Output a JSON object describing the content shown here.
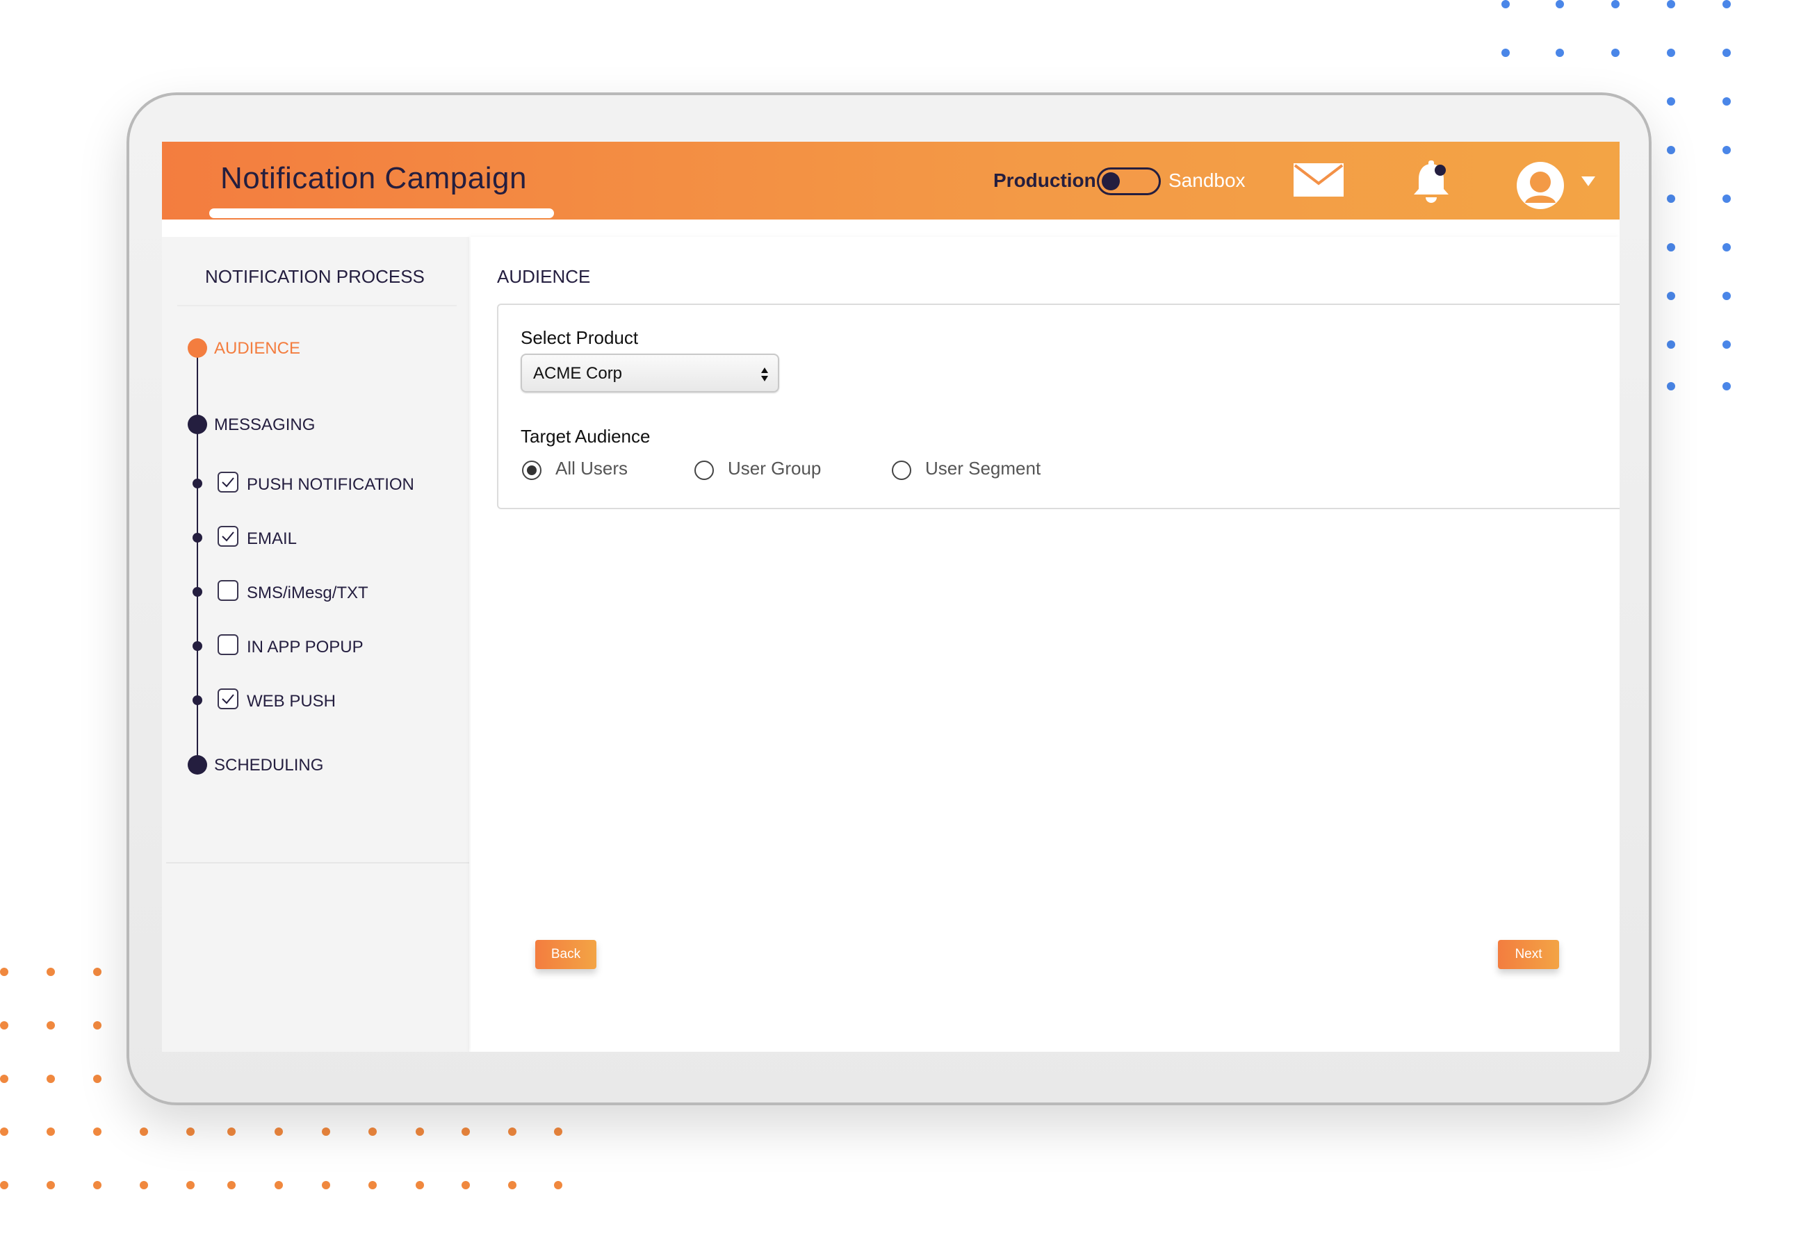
{
  "colors": {
    "accent": "#f37d3f",
    "accent_end": "#f3a445",
    "navy": "#241e3f",
    "dot_blue": "#4a86e8",
    "dot_orange": "#f0883e"
  },
  "header": {
    "title": "Notification Campaign",
    "env_production": "Production",
    "env_sandbox": "Sandbox",
    "env_toggle_state": "production",
    "icons": [
      "mail-icon",
      "bell-icon",
      "avatar-icon",
      "caret-down-icon"
    ]
  },
  "sidebar": {
    "heading": "NOTIFICATION PROCESS",
    "steps": [
      {
        "label": "AUDIENCE",
        "status": "active"
      },
      {
        "label": "MESSAGING",
        "status": "pending"
      },
      {
        "label": "SCHEDULING",
        "status": "pending"
      }
    ],
    "messaging_channels": [
      {
        "label": "PUSH NOTIFICATION",
        "checked": true
      },
      {
        "label": "EMAIL",
        "checked": true
      },
      {
        "label": "SMS/iMesg/TXT",
        "checked": false
      },
      {
        "label": "IN APP POPUP",
        "checked": false
      },
      {
        "label": "WEB PUSH",
        "checked": true
      }
    ]
  },
  "main": {
    "section_title": "AUDIENCE",
    "select_product": {
      "label": "Select Product",
      "value": "ACME Corp"
    },
    "target_audience": {
      "label": "Target Audience",
      "options": [
        {
          "label": "All Users",
          "selected": true
        },
        {
          "label": "User Group",
          "selected": false
        },
        {
          "label": "User Segment",
          "selected": false
        }
      ]
    },
    "back_label": "Back",
    "next_label": "Next"
  }
}
